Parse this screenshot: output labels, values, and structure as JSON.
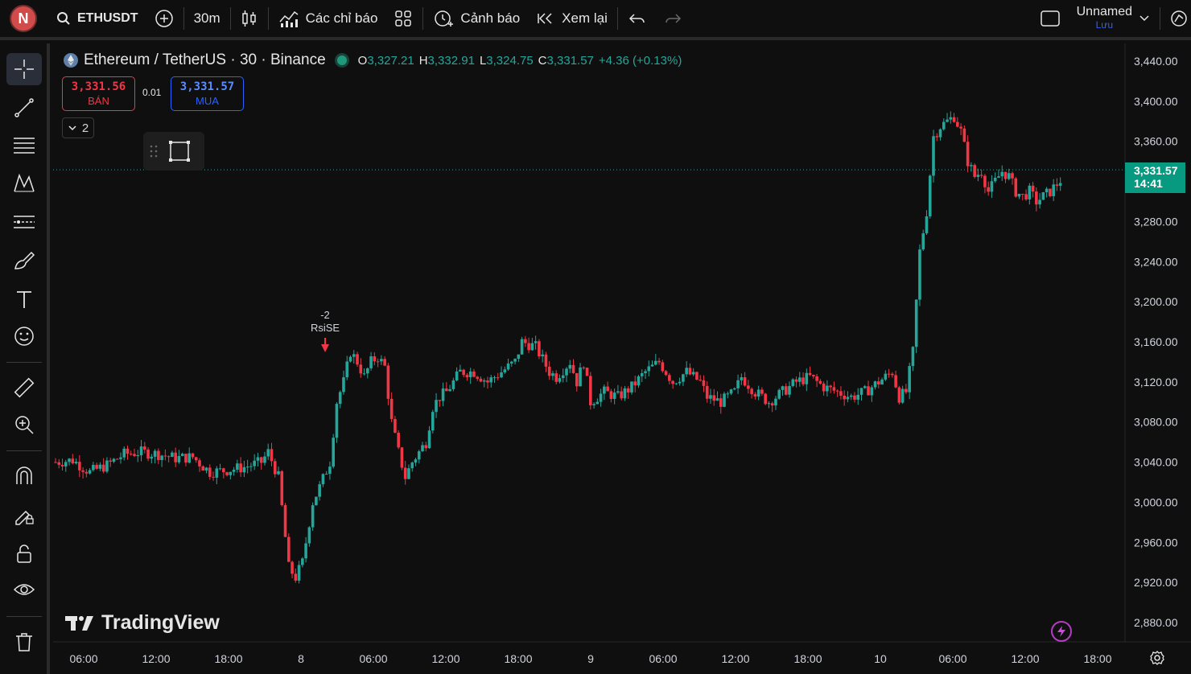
{
  "toolbar": {
    "avatar_letter": "N",
    "symbol": "ETHUSDT",
    "interval": "30m",
    "indicators_label": "Các chỉ báo",
    "alerts_label": "Cảnh báo",
    "replay_label": "Xem lại",
    "layout_name": "Unnamed",
    "layout_status": "Lưu"
  },
  "legend": {
    "title": "Ethereum / TetherUS · 30 · Binance",
    "o_label": "O",
    "o": "3,327.21",
    "h_label": "H",
    "h": "3,332.91",
    "l_label": "L",
    "l": "3,324.75",
    "c_label": "C",
    "c": "3,331.57",
    "change": "+4.36 (+0.13%)"
  },
  "trade": {
    "sell_price": "3,331.56",
    "sell_label": "BÁN",
    "spread": "0.01",
    "buy_price": "3,331.57",
    "buy_label": "MUA"
  },
  "indicators_collapse_count": "2",
  "marker": {
    "line1": "-2",
    "line2": "RsiSE"
  },
  "brand": "TradingView",
  "price_tag": {
    "price": "3,331.57",
    "countdown": "14:41"
  },
  "colors": {
    "up": "#26a69a",
    "down": "#f23645",
    "background": "#0f0f0f",
    "accent": "#2962ff"
  },
  "left_tools": [
    "crosshair-icon",
    "trend-line-icon",
    "fib-icon",
    "pattern-icon",
    "projection-icon",
    "brush-icon",
    "text-icon",
    "emoji-icon",
    "ruler-icon",
    "zoom-in-icon",
    "magnet-icon",
    "lock-draw-icon",
    "lock-icon",
    "eye-icon",
    "trash-icon"
  ],
  "chart_data": {
    "type": "candlestick",
    "y_ticks": [
      "3,440.00",
      "3,400.00",
      "3,360.00",
      "3,280.00",
      "3,240.00",
      "3,200.00",
      "3,160.00",
      "3,120.00",
      "3,080.00",
      "3,040.00",
      "3,000.00",
      "2,960.00",
      "2,920.00",
      "2,880.00"
    ],
    "y_tick_values": [
      3440,
      3400,
      3360,
      3280,
      3240,
      3200,
      3160,
      3120,
      3080,
      3040,
      3000,
      2960,
      2920,
      2880
    ],
    "x_ticks": [
      "06:00",
      "12:00",
      "18:00",
      "8",
      "06:00",
      "12:00",
      "18:00",
      "9",
      "06:00",
      "12:00",
      "18:00",
      "10",
      "06:00",
      "12:00",
      "18:00"
    ],
    "ylim": [
      2866,
      3450
    ],
    "last_price": 3331.57,
    "close_path": [
      [
        0,
        3040
      ],
      [
        5,
        3042
      ],
      [
        10,
        3030
      ],
      [
        15,
        3037
      ],
      [
        20,
        3048
      ],
      [
        25,
        3050
      ],
      [
        30,
        3048
      ],
      [
        35,
        3044
      ],
      [
        40,
        3045
      ],
      [
        45,
        3030
      ],
      [
        50,
        3032
      ],
      [
        55,
        3035
      ],
      [
        60,
        3040
      ],
      [
        62,
        3050
      ],
      [
        65,
        3025
      ],
      [
        68,
        2935
      ],
      [
        70,
        2925
      ],
      [
        72,
        2940
      ],
      [
        75,
        3000
      ],
      [
        77,
        3015
      ],
      [
        80,
        3040
      ],
      [
        82,
        3100
      ],
      [
        84,
        3120
      ],
      [
        86,
        3150
      ],
      [
        88,
        3140
      ],
      [
        90,
        3125
      ],
      [
        92,
        3140
      ],
      [
        94,
        3145
      ],
      [
        96,
        3135
      ],
      [
        98,
        3080
      ],
      [
        100,
        3050
      ],
      [
        102,
        3025
      ],
      [
        104,
        3040
      ],
      [
        106,
        3050
      ],
      [
        108,
        3060
      ],
      [
        110,
        3095
      ],
      [
        112,
        3105
      ],
      [
        114,
        3110
      ],
      [
        118,
        3130
      ],
      [
        122,
        3130
      ],
      [
        126,
        3120
      ],
      [
        130,
        3130
      ],
      [
        134,
        3140
      ],
      [
        136,
        3160
      ],
      [
        140,
        3155
      ],
      [
        144,
        3130
      ],
      [
        146,
        3125
      ],
      [
        150,
        3140
      ],
      [
        152,
        3120
      ],
      [
        154,
        3140
      ],
      [
        156,
        3100
      ],
      [
        160,
        3110
      ],
      [
        164,
        3105
      ],
      [
        168,
        3115
      ],
      [
        172,
        3130
      ],
      [
        176,
        3140
      ],
      [
        180,
        3120
      ],
      [
        184,
        3130
      ],
      [
        188,
        3120
      ],
      [
        190,
        3105
      ],
      [
        194,
        3100
      ],
      [
        198,
        3110
      ],
      [
        200,
        3125
      ],
      [
        204,
        3110
      ],
      [
        208,
        3100
      ],
      [
        212,
        3110
      ],
      [
        216,
        3120
      ],
      [
        220,
        3125
      ],
      [
        224,
        3115
      ],
      [
        228,
        3110
      ],
      [
        232,
        3105
      ],
      [
        236,
        3110
      ],
      [
        240,
        3120
      ],
      [
        244,
        3130
      ],
      [
        246,
        3105
      ],
      [
        248,
        3110
      ],
      [
        250,
        3150
      ],
      [
        252,
        3250
      ],
      [
        254,
        3290
      ],
      [
        256,
        3365
      ],
      [
        258,
        3375
      ],
      [
        260,
        3380
      ],
      [
        262,
        3385
      ],
      [
        264,
        3370
      ],
      [
        266,
        3340
      ],
      [
        268,
        3325
      ],
      [
        270,
        3330
      ],
      [
        272,
        3310
      ],
      [
        274,
        3320
      ],
      [
        276,
        3330
      ],
      [
        278,
        3325
      ],
      [
        280,
        3310
      ],
      [
        282,
        3305
      ],
      [
        284,
        3310
      ],
      [
        286,
        3300
      ],
      [
        290,
        3310
      ],
      [
        294,
        3325
      ],
      [
        298,
        3330
      ],
      [
        302,
        3325
      ],
      [
        306,
        3332
      ]
    ],
    "total_candles": 307
  }
}
